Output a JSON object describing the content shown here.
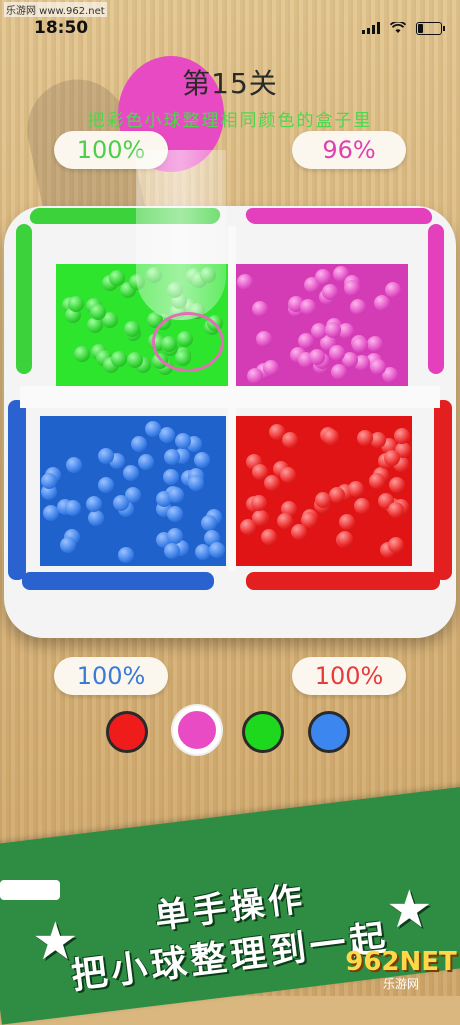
{
  "watermark": "乐游网 www.962.net",
  "status": {
    "time": "18:50"
  },
  "level": {
    "title": "第15关",
    "instruction": "把彩色小球整理相同颜色的盒子里"
  },
  "progress": {
    "green": "100%",
    "magenta": "96%",
    "blue": "100%",
    "red": "100%"
  },
  "colors": {
    "green": "#2ee52e",
    "magenta": "#d43cb6",
    "blue": "#1f62cc",
    "red": "#e01414"
  },
  "color_picker": {
    "options": [
      "red",
      "magenta",
      "green",
      "blue"
    ],
    "selected": "magenta"
  },
  "promo": {
    "line1": "单手操作",
    "line2": "把小球整理到一起"
  },
  "brand": {
    "logo_big": "962NET",
    "logo_small": "乐游网"
  }
}
